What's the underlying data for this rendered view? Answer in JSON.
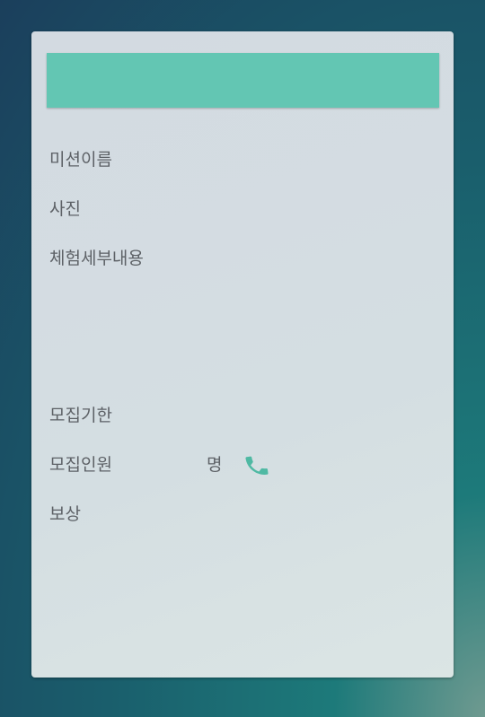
{
  "form": {
    "mission_name_label": "미션이름",
    "photo_label": "사진",
    "details_label": "체험세부내용",
    "deadline_label": "모집기한",
    "headcount_label": "모집인원",
    "headcount_unit": "명",
    "reward_label": "보상"
  },
  "colors": {
    "accent": "#63c6b3",
    "label_text": "#5d6166"
  },
  "icons": {
    "phone": "phone-icon"
  }
}
